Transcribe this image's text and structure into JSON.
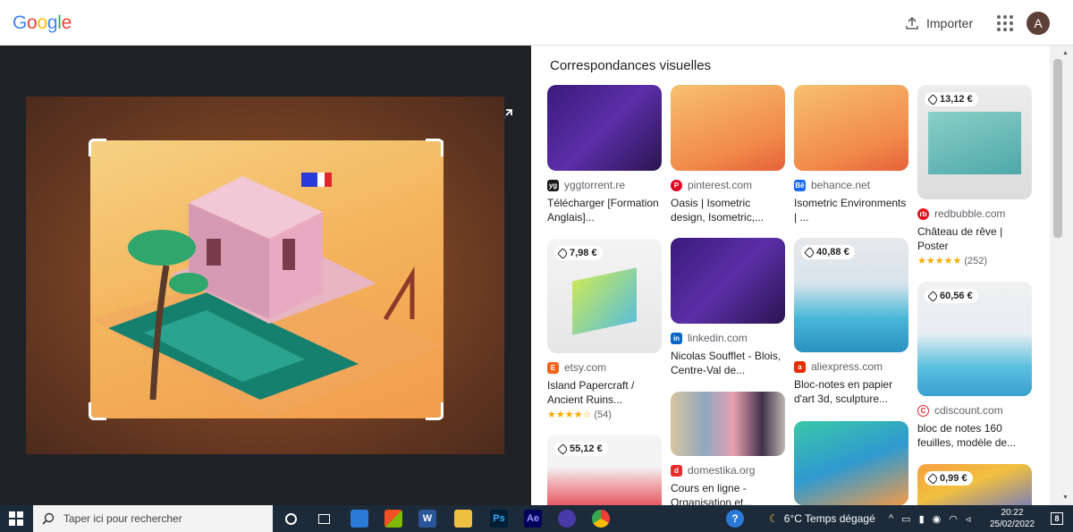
{
  "header": {
    "logo_letters": [
      "G",
      "o",
      "o",
      "g",
      "l",
      "e"
    ],
    "logo_colors": [
      "#4285F4",
      "#EA4335",
      "#FBBC05",
      "#4285F4",
      "#34A853",
      "#EA4335"
    ],
    "import_label": "Importer",
    "avatar_letter": "A"
  },
  "results": {
    "title": "Correspondances visuelles",
    "cards": [
      {
        "source": "yggtorrent.re",
        "title": "Télécharger [Formation Anglais]...",
        "favicon_color": "#1a1a1a",
        "favicon_text": "yg"
      },
      {
        "source": "pinterest.com",
        "title": "Oasis | Isometric design, Isometric,...",
        "favicon_color": "#e60023",
        "favicon_text": "P"
      },
      {
        "source": "behance.net",
        "title": "Isometric Environments | ...",
        "favicon_color": "#1769ff",
        "favicon_text": "Bē"
      },
      {
        "price": "13,12 €",
        "source": "redbubble.com",
        "title": "Château de rêve | Poster",
        "stars": "★★★★★",
        "reviews": "(252)",
        "favicon_color": "#e41321",
        "favicon_text": "rb"
      },
      {
        "price": "7,98 €",
        "source": "etsy.com",
        "title": "Island Papercraft / Ancient Ruins...",
        "stars": "★★★★☆",
        "reviews": "(54)",
        "favicon_color": "#f1641e",
        "favicon_text": "E"
      },
      {
        "source": "linkedin.com",
        "title": "Nicolas Soufflet - Blois, Centre-Val de...",
        "favicon_color": "#0a66c2",
        "favicon_text": "in"
      },
      {
        "price": "40,88 €",
        "source": "aliexpress.com",
        "title": "Bloc-notes en papier d'art 3d, sculpture...",
        "favicon_color": "#e62e04",
        "favicon_text": "a"
      },
      {
        "price": "60,56 €",
        "source": "cdiscount.com",
        "title": "bloc de notes 160 feuilles, modèle de...",
        "favicon_color": "#ffffff",
        "favicon_text": "C"
      },
      {
        "price": "55,12 €"
      },
      {
        "source": "domestika.org",
        "title": "Cours en ligne - Organisation et...",
        "favicon_color": "#e62e2d",
        "favicon_text": "d"
      },
      {},
      {
        "price": "0,99 €"
      }
    ]
  },
  "taskbar": {
    "search_placeholder": "Taper ici pour rechercher",
    "weather": "6°C  Temps dégagé",
    "time": "20:22",
    "date": "25/02/2022",
    "notifications": "8",
    "apps": [
      "Ps",
      "Ae",
      "W"
    ]
  }
}
